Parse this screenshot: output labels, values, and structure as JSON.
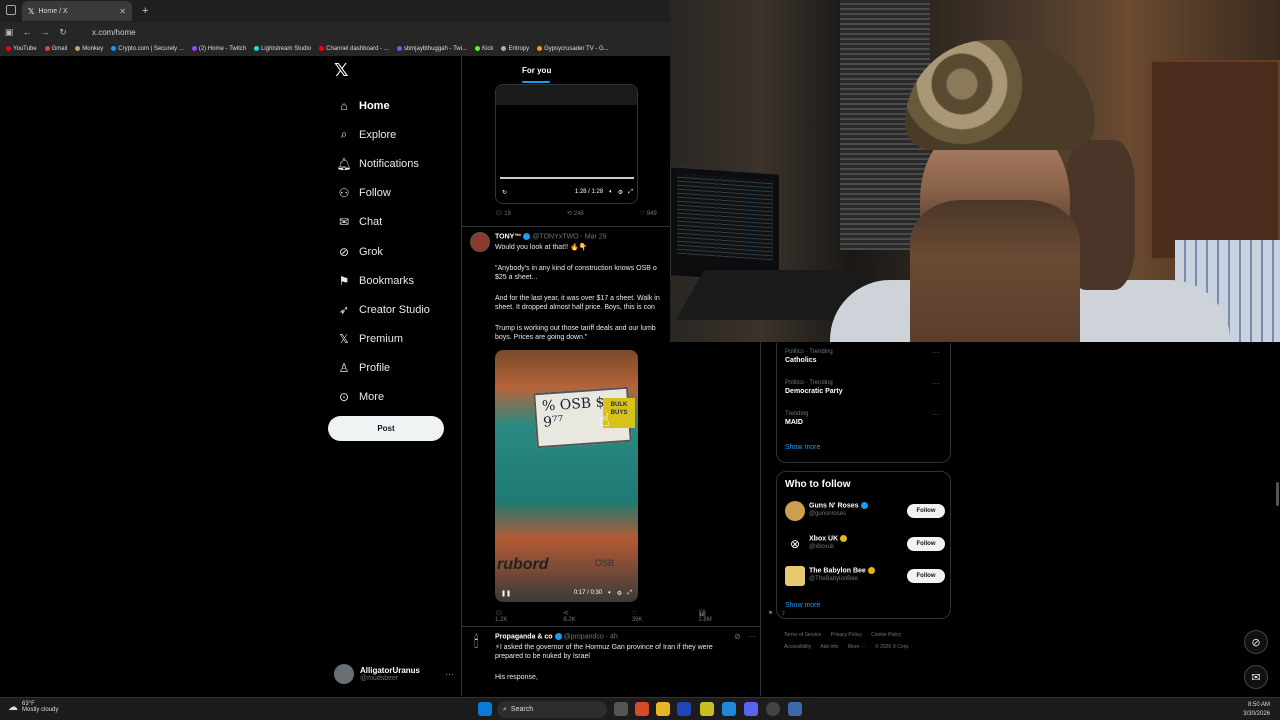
{
  "browser": {
    "tab_title": "Home / X",
    "url": "x.com/home",
    "bookmarks": [
      "YouTube",
      "Gmail",
      "Monkey",
      "Crypto.com | Securely ...",
      "(2) Home - Twitch",
      "Lightstream Studio",
      "Channel dashboard - ...",
      "sbmjaybthuggah - Twi...",
      "Kick",
      "Entropy",
      "Gypsycrusader TV - G..."
    ]
  },
  "nav": {
    "items": [
      {
        "label": "Home",
        "icon": "home-icon"
      },
      {
        "label": "Explore",
        "icon": "search-icon"
      },
      {
        "label": "Notifications",
        "icon": "bell-icon"
      },
      {
        "label": "Follow",
        "icon": "person-plus-icon"
      },
      {
        "label": "Chat",
        "icon": "mail-icon"
      },
      {
        "label": "Grok",
        "icon": "grok-icon"
      },
      {
        "label": "Bookmarks",
        "icon": "bookmark-icon"
      },
      {
        "label": "Creator Studio",
        "icon": "rocket-icon"
      },
      {
        "label": "Premium",
        "icon": "x-icon"
      },
      {
        "label": "Profile",
        "icon": "person-icon"
      },
      {
        "label": "More",
        "icon": "more-circle-icon"
      }
    ],
    "post_label": "Post",
    "account": {
      "name": "AlligatorUranus",
      "handle": "@mudsbeer"
    }
  },
  "feed": {
    "tab": "For you",
    "video1": {
      "time": "1:28 / 1:28",
      "replies": "18",
      "reposts": "248",
      "likes": "949"
    },
    "tweet2": {
      "name": "TONY™",
      "handle": "@TONYxTWO",
      "date": "· Mar 29",
      "lines": [
        "Would you look at that!! 🔥👇",
        "",
        "\"Anybody's in any kind of construction knows OSB o",
        "$25 a sheet...",
        "",
        "And for the last year, it was over $17 a sheet. Walk in",
        "sheet. It dropped almost half price. Boys, this is con",
        "",
        "Trump is working out those tariff deals and our lumb",
        "boys. Prices are going down.\""
      ],
      "video_time": "0:17 / 0:30",
      "sign_text": "% OSB $ 9⁷⁷",
      "bulk_text": "BULK BUYS",
      "board_text": "rubord",
      "osb_text": "OSB",
      "replies": "1.2K",
      "reposts": "8.2K",
      "likes": "39K",
      "views": "1.8M"
    },
    "tweet3": {
      "name": "Propaganda & co",
      "handle": "@propandco",
      "date": "· 4h",
      "lines": [
        "⚡I asked the governor of the Hormuz Gan province of Iran if they were",
        "prepared to be nuked by Israel",
        "",
        "His response,"
      ]
    }
  },
  "trends": [
    {
      "category": "Politics · Trending",
      "name": "Catholics"
    },
    {
      "category": "Politics · Trending",
      "name": "Democratic Party"
    },
    {
      "category": "Trending",
      "name": "MAID"
    }
  ],
  "trends_show_more": "Show more",
  "who_to_follow": {
    "title": "Who to follow",
    "accounts": [
      {
        "name": "Guns N' Roses",
        "handle": "@gunsnroses",
        "button": "Follow"
      },
      {
        "name": "Xbox UK",
        "handle": "@xboxuk",
        "button": "Follow"
      },
      {
        "name": "The Babylon Bee",
        "handle": "@TheBabylonBee",
        "button": "Follow"
      }
    ],
    "show_more": "Show more"
  },
  "footer": {
    "links": [
      "Terms of Service",
      "Privacy Policy",
      "Cookie Policy",
      "Accessibility",
      "Ads info",
      "More ···",
      "© 2026 X Corp."
    ]
  },
  "taskbar": {
    "temp": "63°F",
    "weather": "Mostly cloudy",
    "search": "Search",
    "time": "8:50 AM",
    "date": "3/30/2026"
  }
}
